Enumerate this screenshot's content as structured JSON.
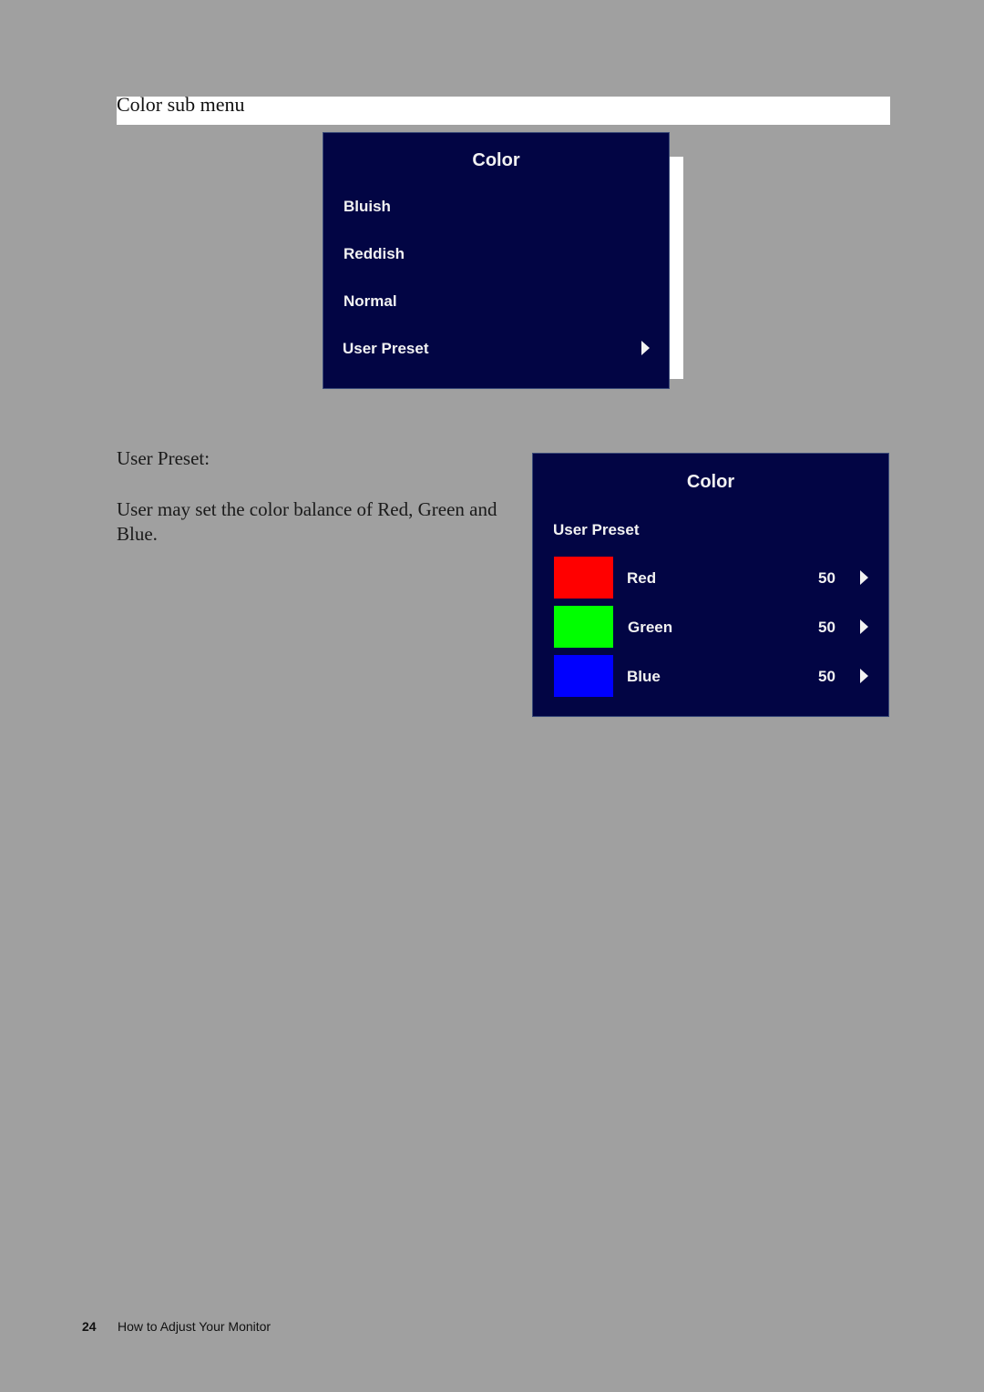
{
  "section": {
    "title": "Color sub menu"
  },
  "osd_color_menu": {
    "title": "Color",
    "items": [
      {
        "label": "Bluish",
        "has_submenu": false
      },
      {
        "label": "Reddish",
        "has_submenu": false
      },
      {
        "label": "Normal",
        "has_submenu": false
      },
      {
        "label": "User Preset",
        "has_submenu": true
      }
    ]
  },
  "description": {
    "heading": "User Preset:",
    "text": "User may set the color balance of Red, Green and Blue."
  },
  "osd_user_preset": {
    "title": "Color",
    "subtitle": "User Preset",
    "channels": [
      {
        "label": "Red",
        "value": "50",
        "color": "#ff0000"
      },
      {
        "label": "Green",
        "value": "50",
        "color": "#00ff00"
      },
      {
        "label": "Blue",
        "value": "50",
        "color": "#0000ff"
      }
    ]
  },
  "colors": {
    "osd_background": "#020544",
    "page_background": "#a0a0a0"
  },
  "footer": {
    "page_number": "24",
    "chapter": "How to Adjust Your Monitor"
  }
}
